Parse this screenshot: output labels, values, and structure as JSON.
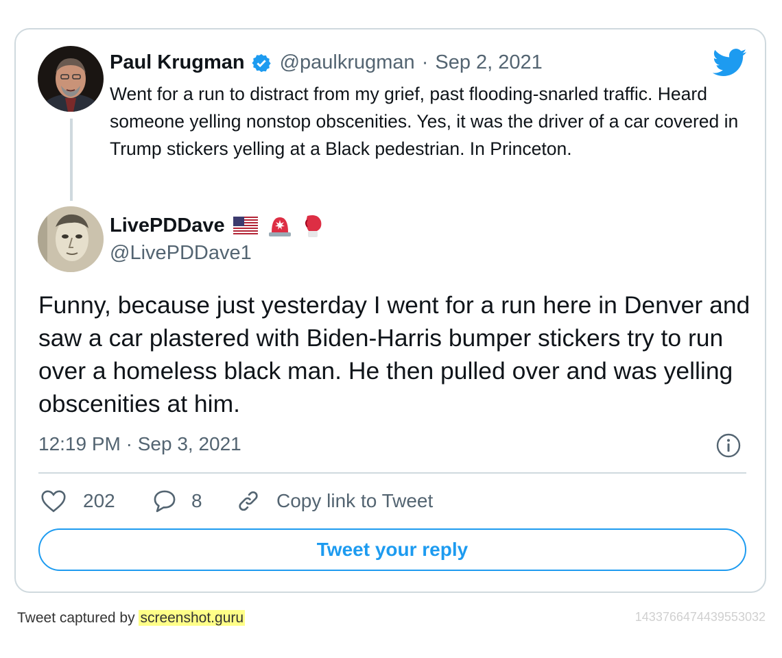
{
  "quoted_tweet": {
    "author_name": "Paul Krugman",
    "verified_icon": "verified-badge-icon",
    "handle": "@paulkrugman",
    "separator": "·",
    "date": "Sep 2, 2021",
    "text": "Went for a run to distract from my grief, past flooding-snarled traffic. Heard someone yelling nonstop obscenities. Yes, it was the driver of a car covered in Trump stickers yelling at a Black pedestrian. In Princeton.",
    "brand_icon": "twitter-bird-icon"
  },
  "reply_tweet": {
    "author_name": "LivePDDave",
    "name_emojis": [
      "us-flag-icon",
      "police-light-icon",
      "boxing-glove-icon"
    ],
    "handle": "@LivePDDave1",
    "text": "Funny, because just yesterday I went for a run here in Denver and saw a car plastered with Biden-Harris bumper stickers try to run over a homeless black man. He then pulled over and was yelling obscenities at him.",
    "timestamp": "12:19 PM · Sep 3, 2021",
    "info_icon": "info-icon"
  },
  "actions": {
    "like_count": "202",
    "reply_count": "8",
    "copy_link_label": "Copy link to Tweet",
    "reply_button_label": "Tweet your reply"
  },
  "footer": {
    "captured_by": "Tweet captured by",
    "site": "screenshot.guru",
    "tweet_id": "1433766474439553032"
  },
  "colors": {
    "accent": "#1d9bf0",
    "border": "#cfd9de",
    "secondary_text": "#536471",
    "highlight": "#ffff88"
  }
}
